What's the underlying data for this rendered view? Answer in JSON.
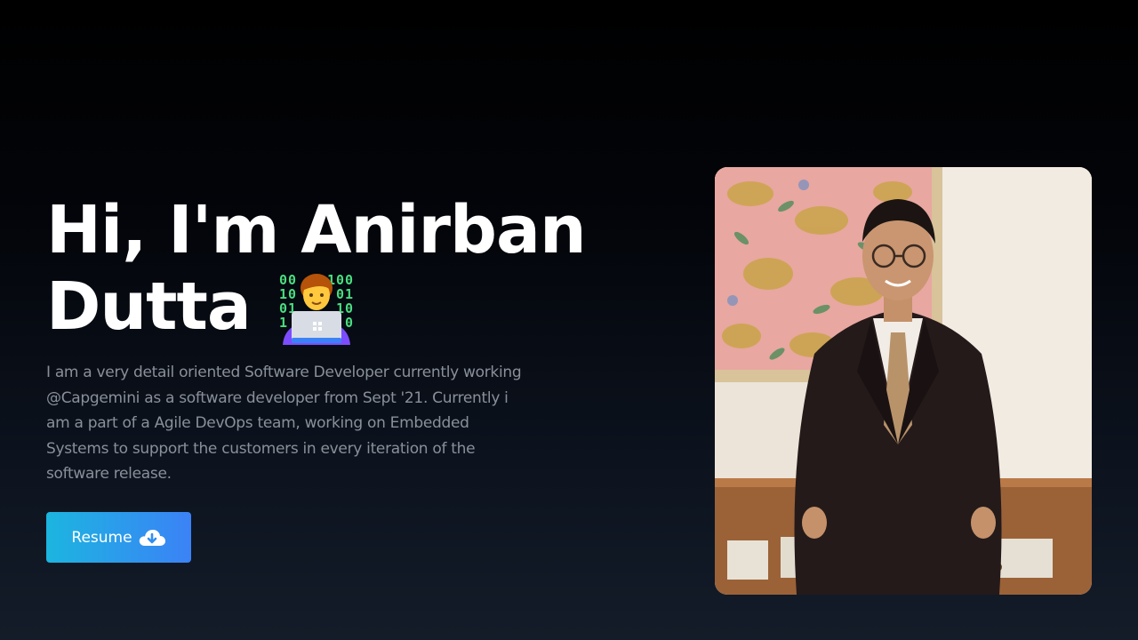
{
  "hero": {
    "title_line1": "Hi, I'm Anirban",
    "title_line2": "Dutta",
    "emoji": "technologist-emoji",
    "intro": "I am a very detail oriented Software Developer currently working @Capgemini as a software developer from Sept '21. Currently i am a part of a Agile DevOps team, working on Embedded Systems to support the customers in every iteration of the software release.",
    "resume_label": "Resume",
    "resume_icon": "cloud-download-icon",
    "photo": "profile-photo"
  },
  "colors": {
    "background_top": "#000000",
    "background_bottom": "#141c29",
    "text_primary": "#ffffff",
    "text_muted": "#8a9099",
    "button_gradient_start": "#1cb5e0",
    "button_gradient_end": "#3b82f6"
  }
}
